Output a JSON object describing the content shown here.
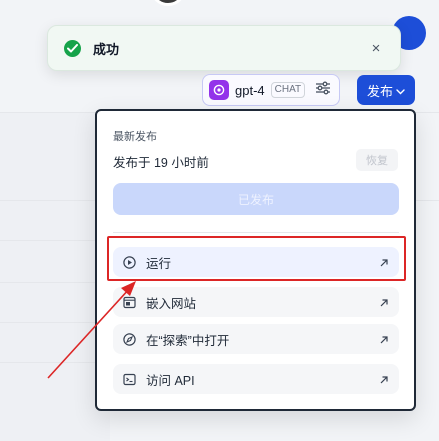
{
  "toast": {
    "title": "成功",
    "close_label": "×"
  },
  "model": {
    "name": "gpt-4",
    "badge": "CHAT"
  },
  "publish_button": {
    "label": "发布"
  },
  "dropdown": {
    "latest_label": "最新发布",
    "published_time": "发布于 19 小时前",
    "restore_label": "恢复",
    "published_label": "已发布",
    "items": [
      {
        "label": "运行",
        "icon": "play-circle-icon"
      },
      {
        "label": "嵌入网站",
        "icon": "embed-window-icon"
      },
      {
        "label": "在“探索”中打开",
        "icon": "compass-icon"
      },
      {
        "label": "访问 API",
        "icon": "terminal-icon"
      }
    ]
  },
  "colors": {
    "accent": "#1d4ed8",
    "success": "#16a34a",
    "annotation": "#dc2626"
  }
}
